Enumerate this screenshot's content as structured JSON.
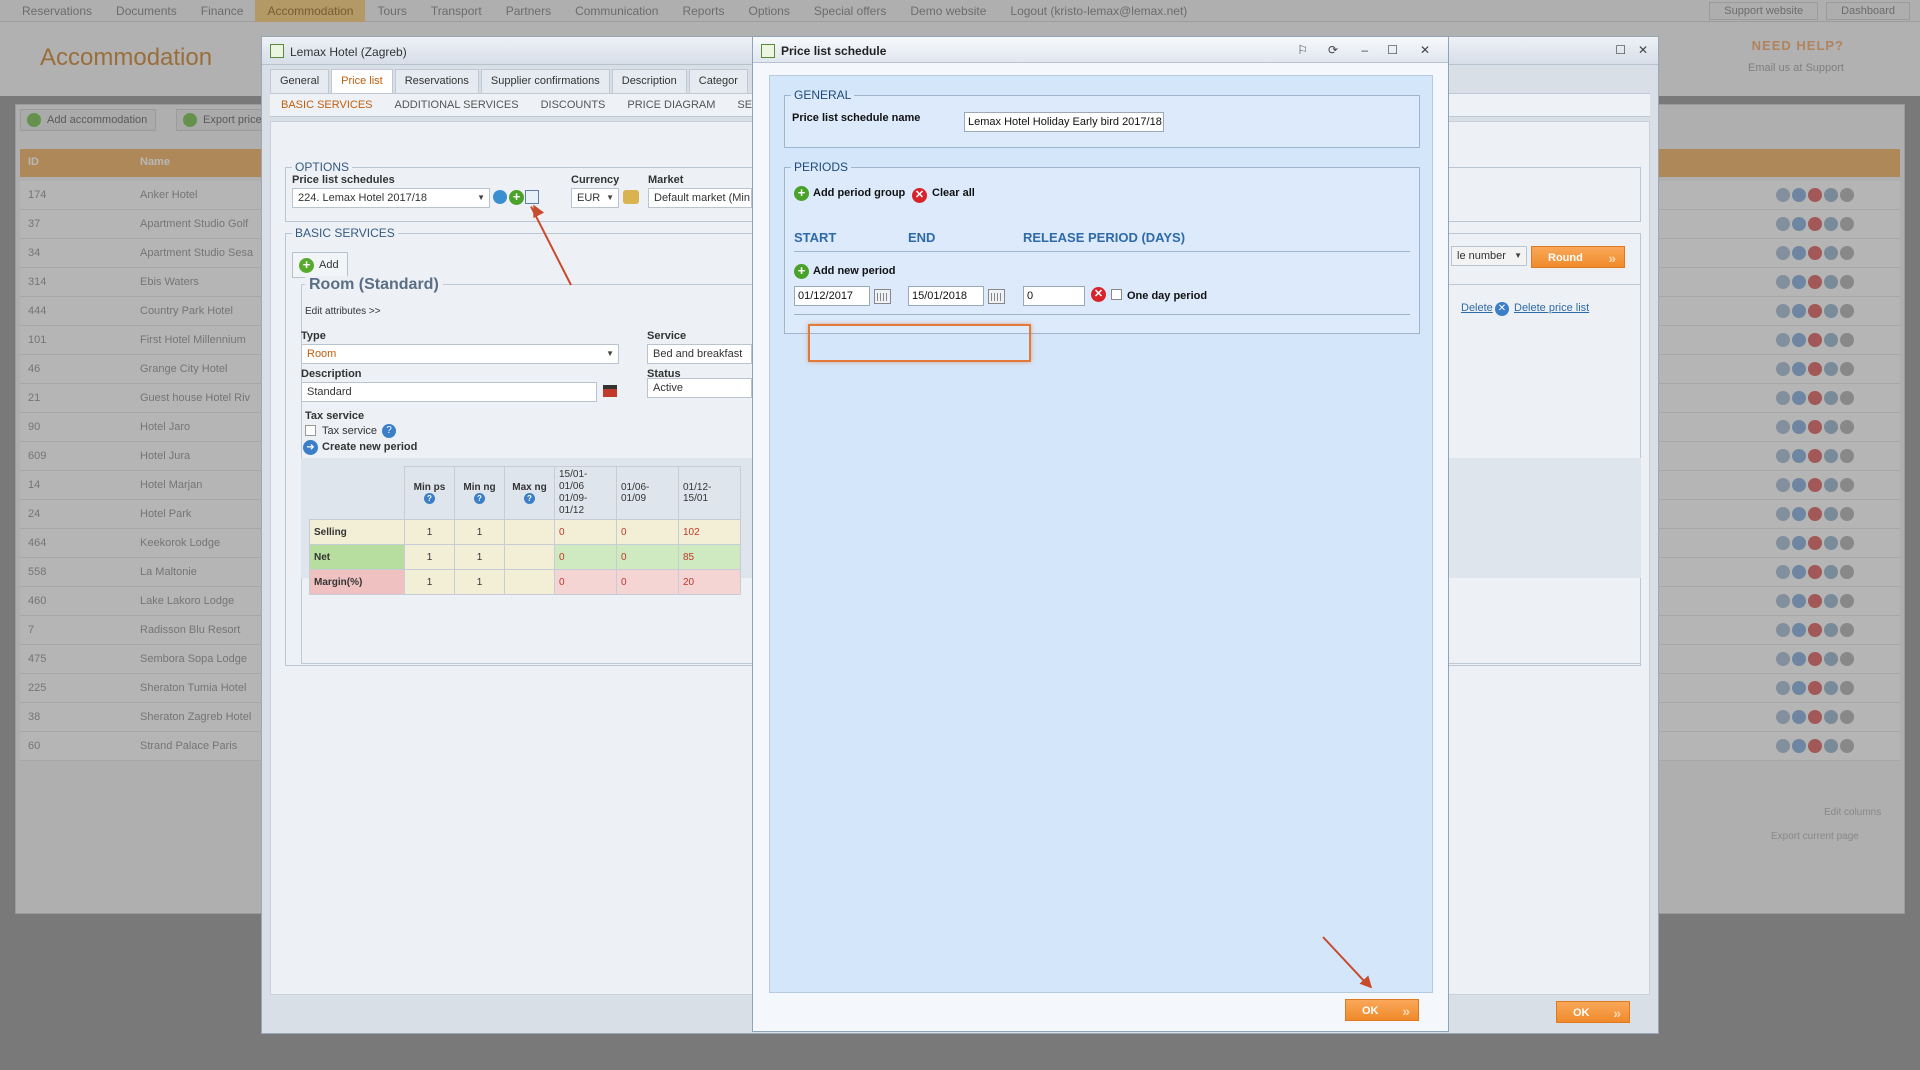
{
  "topbar": {
    "nav": [
      "Reservations",
      "Documents",
      "Finance",
      "Accommodation",
      "Tours",
      "Transport",
      "Partners",
      "Communication",
      "Reports",
      "Options",
      "Special offers",
      "Demo website",
      "Logout (kristo-lemax@lemax.net)"
    ],
    "active_index": 3,
    "right": [
      "Support website",
      "Dashboard"
    ]
  },
  "page": {
    "title": "Accommodation",
    "help": "NEED HELP?",
    "help_sub": "Email us at Support",
    "buttons": [
      "Add accommodation",
      "Export price"
    ],
    "col_ids": "ID",
    "col_name": "Name",
    "rows": [
      {
        "id": "174",
        "name": "Anker Hotel"
      },
      {
        "id": "37",
        "name": "Apartment Studio Golf"
      },
      {
        "id": "34",
        "name": "Apartment Studio Sesa"
      },
      {
        "id": "314",
        "name": "Ebis Waters"
      },
      {
        "id": "444",
        "name": "Country Park Hotel"
      },
      {
        "id": "101",
        "name": "First Hotel Millennium"
      },
      {
        "id": "46",
        "name": "Grange City Hotel"
      },
      {
        "id": "21",
        "name": "Guest house Hotel Riv"
      },
      {
        "id": "90",
        "name": "Hotel Jaro"
      },
      {
        "id": "609",
        "name": "Hotel Jura"
      },
      {
        "id": "14",
        "name": "Hotel Marjan"
      },
      {
        "id": "24",
        "name": "Hotel Park"
      },
      {
        "id": "464",
        "name": "Keekorok Lodge"
      },
      {
        "id": "558",
        "name": "La Maltonie"
      },
      {
        "id": "460",
        "name": "Lake Lakoro Lodge"
      },
      {
        "id": "7",
        "name": "Radisson Blu Resort"
      },
      {
        "id": "475",
        "name": "Sembora Sopa Lodge"
      },
      {
        "id": "225",
        "name": "Sheraton Tumia Hotel"
      },
      {
        "id": "38",
        "name": "Sheraton Zagreb Hotel"
      },
      {
        "id": "60",
        "name": "Strand Palace Paris"
      }
    ],
    "edit_columns": "Edit columns",
    "export": "Export current page"
  },
  "hotel_window": {
    "title": "Lemax Hotel (Zagreb)",
    "tabs": [
      "General",
      "Price list",
      "Reservations",
      "Supplier confirmations",
      "Description",
      "Categor"
    ],
    "active_tab": "Price list",
    "subtabs": [
      "BASIC SERVICES",
      "ADDITIONAL SERVICES",
      "DISCOUNTS",
      "PRICE DIAGRAM",
      "SEASONS"
    ],
    "options_legend": "OPTIONS",
    "pls_label": "Price list schedules",
    "pls_value": "224. Lemax Hotel 2017/18",
    "currency_label": "Currency",
    "currency_value": "EUR",
    "market_label": "Market",
    "market_value": "Default market (Min",
    "basic_legend": "BASIC SERVICES",
    "add_label": "Add",
    "room_title": "Room (Standard)",
    "edit_attributes": "Edit attributes >>",
    "type_label": "Type",
    "type_value": "Room",
    "service_label": "Service",
    "service_value": "Bed and breakfast",
    "description_label": "Description",
    "description_value": "Standard",
    "status_label": "Status",
    "status_value": "Active",
    "tax_label": "Tax service",
    "tax_service": "Tax service",
    "create_period": "Create new period",
    "right_partial": "le number",
    "round_label": "Round",
    "delete_label": "Delete",
    "delete_price_list": "Delete price list",
    "ok_label": "OK",
    "grid": {
      "headers": [
        "Min ps",
        "Min ng",
        "Max ng",
        "15/01-01/06\n01/09-01/12",
        "01/06-01/09",
        "01/12-15/01"
      ],
      "rows": [
        {
          "label": "Selling",
          "min_ps": "1",
          "min_ng": "1",
          "max_ng": "",
          "p1": "0",
          "p2": "0",
          "p3": "102"
        },
        {
          "label": "Net",
          "min_ps": "1",
          "min_ng": "1",
          "max_ng": "",
          "p1": "0",
          "p2": "0",
          "p3": "85"
        },
        {
          "label": "Margin(%)",
          "min_ps": "1",
          "min_ng": "1",
          "max_ng": "",
          "p1": "0",
          "p2": "0",
          "p3": "20"
        }
      ]
    }
  },
  "dialog": {
    "title": "Price list schedule",
    "general_legend": "GENERAL",
    "name_label": "Price list schedule name",
    "name_value": "Lemax Hotel Holiday Early bird 2017/18",
    "periods_legend": "PERIODS",
    "add_period_group": "Add period group",
    "clear_all": "Clear all",
    "col_start": "START",
    "col_end": "END",
    "col_release": "RELEASE PERIOD (DAYS)",
    "add_new_period": "Add new period",
    "start_value": "01/12/2017",
    "end_value": "15/01/2018",
    "release_value": "0",
    "one_day_period": "One day period",
    "ok_label": "OK"
  },
  "colors": {
    "accent_orange": "#f08a2a",
    "header_blue": "#2f6aa8",
    "annotation_red": "#c94a2c"
  }
}
